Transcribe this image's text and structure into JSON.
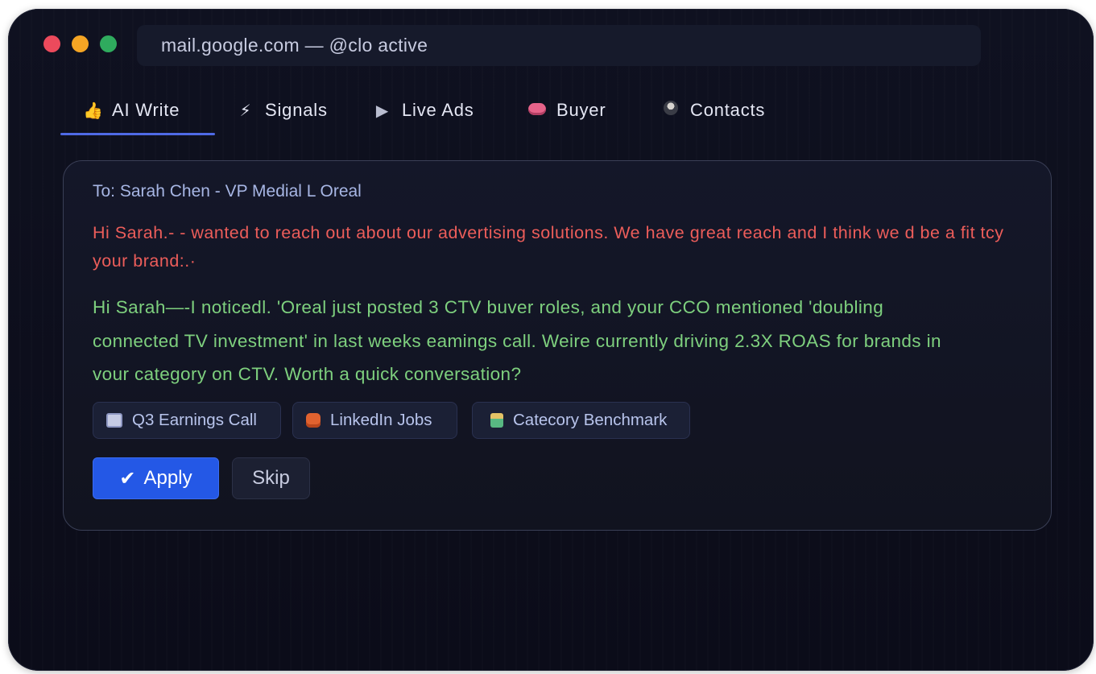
{
  "browser": {
    "url_text": "mail.google.com —  @clo active"
  },
  "tabs": [
    {
      "label": "AI Write",
      "icon": "thumbs-up-icon",
      "active": true
    },
    {
      "label": "Signals",
      "icon": "lightning-icon",
      "active": false
    },
    {
      "label": "Live Ads",
      "icon": "play-icon",
      "active": false
    },
    {
      "label": "Buyer",
      "icon": "brain-icon",
      "active": false
    },
    {
      "label": "Contacts",
      "icon": "person-icon",
      "active": false
    }
  ],
  "email": {
    "to": "To: Sarah Chen - VP Medial L Oreal",
    "original_draft": "Hi Sarah.- - wanted to reach out about our advertising solutions. We have great reach and I think we d be a fit tcy your brand:.·",
    "suggested_draft": "Hi Sarah—-I noticedl. 'Oreal just posted 3 CTV buver roles, and your CCO mentioned 'doubling connected TV investment' in last weeks eamings call. Weire currently driving 2.3X ROAS for brands in vour category on CTV. Worth a quick conversation?"
  },
  "sources": [
    {
      "label": "Q3 Earnings Call",
      "icon": "calendar-icon"
    },
    {
      "label": "LinkedIn Jobs",
      "icon": "briefcase-icon"
    },
    {
      "label": "Catecory Benchmark",
      "icon": "chart-icon"
    }
  ],
  "actions": {
    "apply_label": "Apply",
    "skip_label": "Skip"
  },
  "colors": {
    "accent": "#2458e6",
    "original_text": "#ec5d5a",
    "suggested_text": "#7ed07e"
  }
}
